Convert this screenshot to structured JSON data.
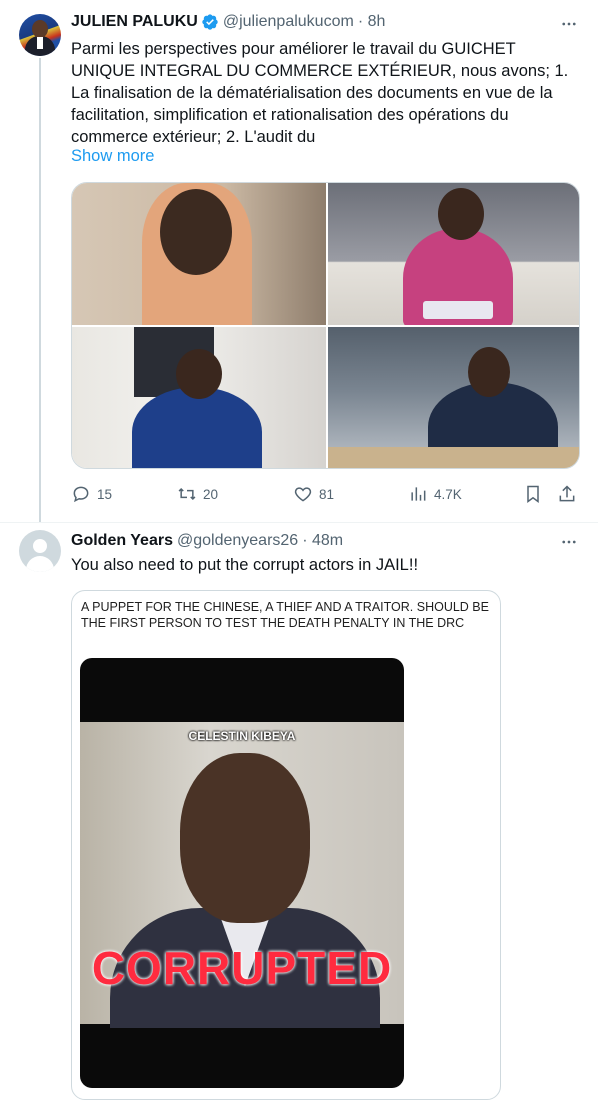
{
  "tweets": [
    {
      "author_name": "JULIEN PALUKU",
      "handle": "@julienpalukucom",
      "time": "· 8h",
      "verified": true,
      "text": "Parmi les perspectives pour améliorer le travail du GUICHET UNIQUE INTEGRAL DU COMMERCE EXTÉRIEUR, nous avons; 1. La finalisation de la dématérialisation des documents en vue de la facilitation, simplification et rationalisation des opérations du commerce extérieur; 2. L'audit du",
      "show_more": "Show more",
      "actions": {
        "replies": "15",
        "retweets": "20",
        "likes": "81",
        "views": "4.7K"
      },
      "icons": [
        "more-icon",
        "verified-badge-icon",
        "reply-icon",
        "retweet-icon",
        "like-icon",
        "views-icon",
        "bookmark-icon",
        "share-icon"
      ]
    },
    {
      "author_name": "Golden Years",
      "handle": "@goldenyears26",
      "time": "· 48m",
      "text": "You also need to put the corrupt actors in JAIL!!",
      "quote_caption": "A PUPPET FOR THE CHINESE, A THIEF AND A TRAITOR. SHOULD BE THE FIRST PERSON TO TEST THE DEATH PENALTY IN THE DRC",
      "quote_label": "CELESTIN KIBEYA",
      "quote_stamp": "CORRUPTED"
    }
  ],
  "colors": {
    "accent": "#1d9bf0",
    "secondary_text": "#536471",
    "border": "#cfd9de",
    "stamp_red": "#ff2b3f"
  }
}
